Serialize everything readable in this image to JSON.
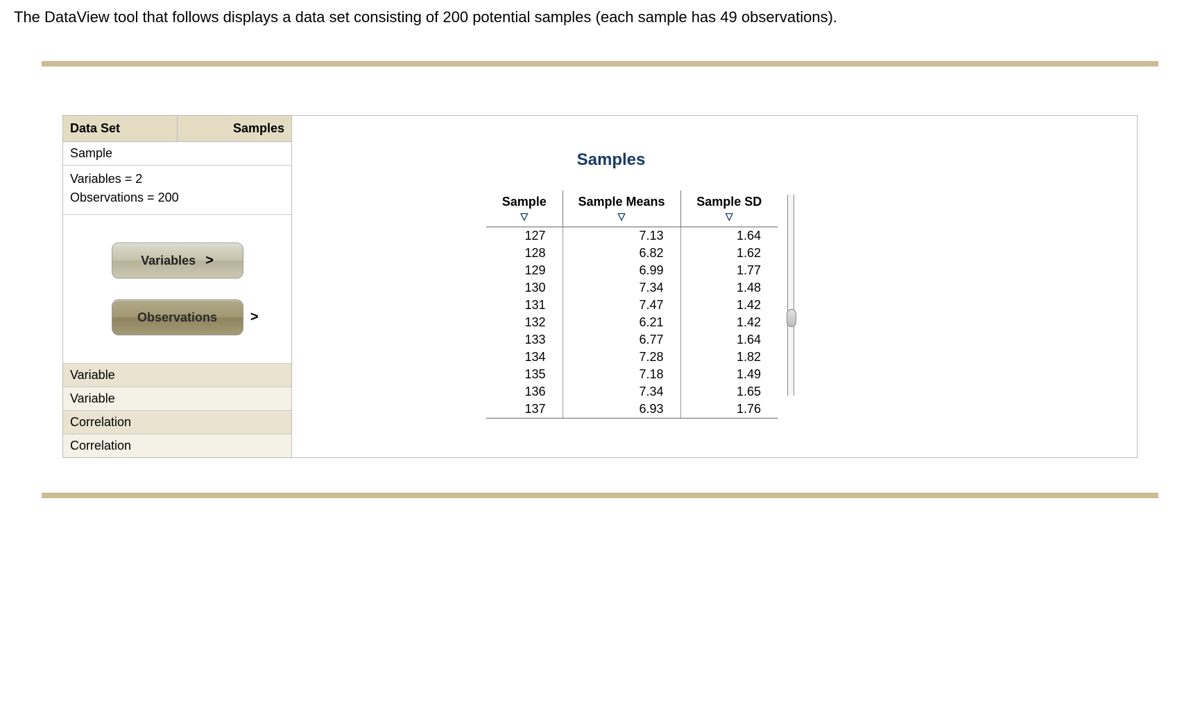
{
  "intro_text": "The DataView tool that follows displays a data set consisting of 200 potential samples (each sample has 49 observations).",
  "sidebar": {
    "tabs": {
      "dataset": "Data Set",
      "samples": "Samples"
    },
    "sample_label": "Sample",
    "variables_line": "Variables = 2",
    "observations_line": "Observations = 200",
    "btn_variables": "Variables",
    "btn_observations": "Observations",
    "bottom_items": [
      "Variable",
      "Variable",
      "Correlation",
      "Correlation"
    ]
  },
  "panel": {
    "title": "Samples",
    "headers": {
      "sample": "Sample",
      "means": "Sample Means",
      "sd": "Sample SD"
    },
    "rows": [
      {
        "sample": "127",
        "mean": "7.13",
        "sd": "1.64"
      },
      {
        "sample": "128",
        "mean": "6.82",
        "sd": "1.62"
      },
      {
        "sample": "129",
        "mean": "6.99",
        "sd": "1.77"
      },
      {
        "sample": "130",
        "mean": "7.34",
        "sd": "1.48"
      },
      {
        "sample": "131",
        "mean": "7.47",
        "sd": "1.42"
      },
      {
        "sample": "132",
        "mean": "6.21",
        "sd": "1.42"
      },
      {
        "sample": "133",
        "mean": "6.77",
        "sd": "1.64"
      },
      {
        "sample": "134",
        "mean": "7.28",
        "sd": "1.82"
      },
      {
        "sample": "135",
        "mean": "7.18",
        "sd": "1.49"
      },
      {
        "sample": "136",
        "mean": "7.34",
        "sd": "1.65"
      },
      {
        "sample": "137",
        "mean": "6.93",
        "sd": "1.76"
      }
    ]
  }
}
